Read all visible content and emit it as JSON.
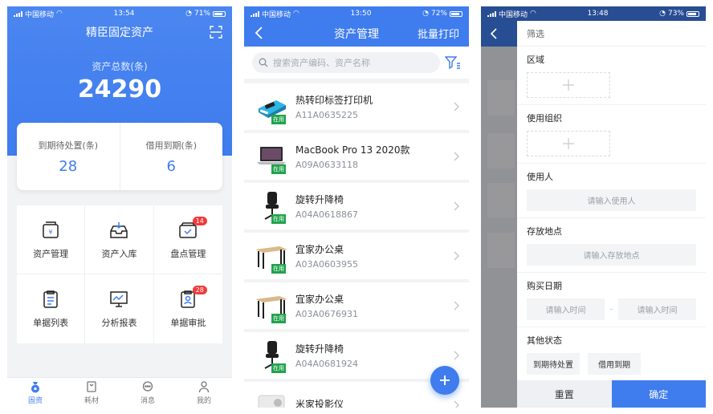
{
  "status": {
    "carrier": "中国移动",
    "screen1": {
      "time": "13:54",
      "battery": "71%"
    },
    "screen2": {
      "time": "13:50",
      "battery": "72%"
    },
    "screen3": {
      "time": "13:48",
      "battery": "73%"
    }
  },
  "home": {
    "title": "精臣固定资产",
    "total_label": "资产总数(条)",
    "total_value": "24290",
    "stats": [
      {
        "label": "到期待处置(条)",
        "value": "28"
      },
      {
        "label": "借用到期(条)",
        "value": "6"
      }
    ],
    "grid": [
      {
        "label": "资产管理",
        "icon": "asset-management-icon",
        "badge": null
      },
      {
        "label": "资产入库",
        "icon": "asset-inbound-icon",
        "badge": null
      },
      {
        "label": "盘点管理",
        "icon": "inventory-icon",
        "badge": "14"
      },
      {
        "label": "单据列表",
        "icon": "document-list-icon",
        "badge": null
      },
      {
        "label": "分析报表",
        "icon": "analysis-report-icon",
        "badge": null
      },
      {
        "label": "单据审批",
        "icon": "approval-icon",
        "badge": "28"
      }
    ],
    "tabs": [
      {
        "label": "固资",
        "icon": "fixed-asset-tab-icon",
        "active": true
      },
      {
        "label": "耗材",
        "icon": "consumables-tab-icon",
        "active": false
      },
      {
        "label": "消息",
        "icon": "message-tab-icon",
        "active": false
      },
      {
        "label": "我的",
        "icon": "profile-tab-icon",
        "active": false
      }
    ]
  },
  "assets": {
    "title": "资产管理",
    "batch_print": "批量打印",
    "search_placeholder": "搜索资产编码、资产名称",
    "status_tag": "在用",
    "items": [
      {
        "name": "热转印标签打印机",
        "code": "A11A0635225",
        "icon": "label-printer-icon"
      },
      {
        "name": "MacBook Pro 13 2020款",
        "code": "A09A0633118",
        "icon": "laptop-icon"
      },
      {
        "name": "旋转升降椅",
        "code": "A04A0618867",
        "icon": "office-chair-icon"
      },
      {
        "name": "宜家办公桌",
        "code": "A03A0603955",
        "icon": "desk-icon"
      },
      {
        "name": "宜家办公桌",
        "code": "A03A0676931",
        "icon": "desk-icon"
      },
      {
        "name": "旋转升降椅",
        "code": "A04A0681924",
        "icon": "office-chair-icon"
      },
      {
        "name": "米家投影仪",
        "code": "",
        "icon": "projector-icon"
      }
    ]
  },
  "filter": {
    "title": "筛选",
    "region": "区域",
    "org": "使用组织",
    "user": "使用人",
    "user_placeholder": "请输入使用人",
    "location": "存放地点",
    "location_placeholder": "请输入存放地点",
    "purchase_date": "购买日期",
    "time_placeholder": "请输入时间",
    "other_status": "其他状态",
    "chips": [
      "到期待处置",
      "借用到期"
    ],
    "reset": "重置",
    "confirm": "确定"
  },
  "colors": {
    "primary": "#3f7cee",
    "badge": "#f23a3a",
    "tag": "#21a34d"
  }
}
